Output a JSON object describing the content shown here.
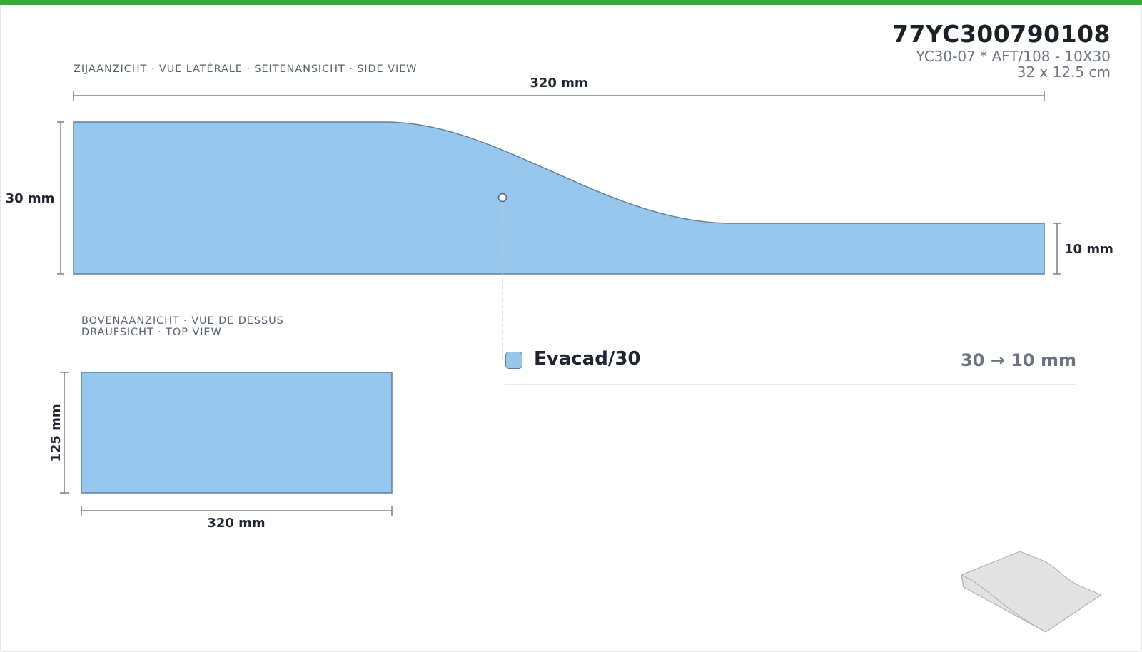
{
  "header": {
    "code": "77YC300790108",
    "description": "YC30-07 * AFT/108 - 10X30",
    "size": "32 x 12.5 cm"
  },
  "side_view": {
    "label": "ZIJAANZICHT · VUE LATÉRALE · SEITENANSICHT · SIDE VIEW",
    "length_label": "320 mm",
    "left_height_label": "30 mm",
    "right_height_label": "10 mm"
  },
  "top_view": {
    "label_line1": "BOVENAANZICHT · VUE DE DESSUS",
    "label_line2": "DRAUFSICHT · TOP VIEW",
    "width_label": "125 mm",
    "length_label": "320 mm"
  },
  "legend": {
    "name": "Evacad/30",
    "range": "30 → 10 mm",
    "color": "#97c7ec"
  },
  "colors": {
    "accent_bar": "#36a936",
    "fill": "#97c7ec",
    "outline": "#5f7f9c"
  }
}
